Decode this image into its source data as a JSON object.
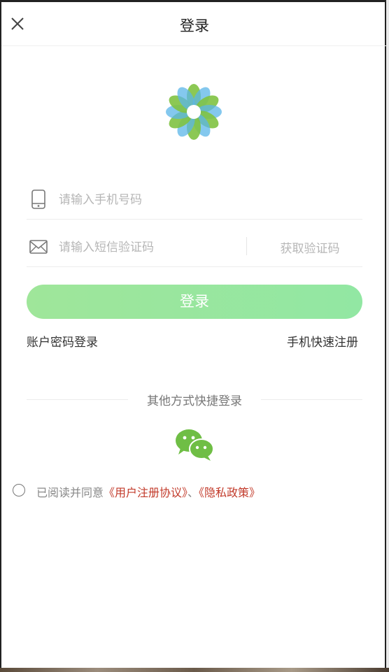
{
  "header": {
    "title": "登录"
  },
  "form": {
    "phone_placeholder": "请输入手机号码",
    "code_placeholder": "请输入短信验证码",
    "get_code_label": "获取验证码",
    "login_label": "登录"
  },
  "links": {
    "password_login": "账户密码登录",
    "quick_register": "手机快速注册"
  },
  "other": {
    "label": "其他方式快捷登录"
  },
  "agreement": {
    "prefix": "已阅读并同意",
    "user_agreement": "《用户注册协议》",
    "separator": "、",
    "privacy_policy": "《隐私政策》"
  },
  "colors": {
    "accent_green": "#9fe69a",
    "link_red": "#c23a2a",
    "wechat_green": "#6fbe45"
  },
  "icons": [
    "close-icon",
    "app-logo",
    "phone-icon",
    "mail-icon",
    "wechat-icon"
  ]
}
